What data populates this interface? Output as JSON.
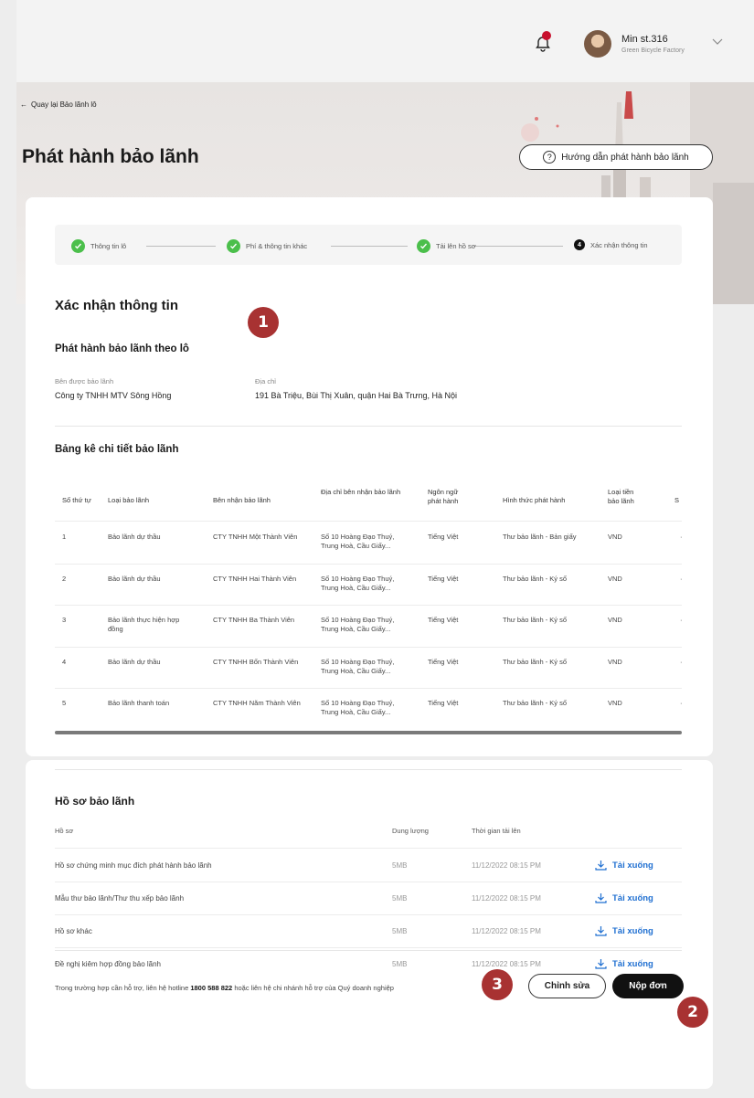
{
  "header": {
    "user_name": "Min st.316",
    "user_org": "Green Bicycle Factory"
  },
  "page": {
    "back_label": "Quay lại Bảo lãnh lô",
    "title": "Phát hành bảo lãnh",
    "guide_label": "Hướng dẫn phát hành bảo lãnh"
  },
  "stepper": {
    "steps": [
      {
        "label": "Thông tin lô",
        "state": "done"
      },
      {
        "label": "Phí & thông tin khác",
        "state": "done"
      },
      {
        "label": "Tải lên hồ sơ",
        "state": "done"
      },
      {
        "label": "Xác nhận thông tin",
        "state": "current",
        "number": "4"
      }
    ]
  },
  "markers": [
    "1",
    "2",
    "3"
  ],
  "confirm": {
    "title": "Xác nhận thông tin",
    "subtitle": "Phát hành bảo lãnh theo lô",
    "beneficiary_label": "Bên được bảo lãnh",
    "beneficiary_value": "Công ty TNHH MTV Sông Hồng",
    "address_label": "Địa chỉ",
    "address_value": "191 Bà Triệu, Bùi Thị Xuân, quận Hai Bà Trưng, Hà Nội"
  },
  "detail_table": {
    "title": "Bảng kê chi tiết bảo lãnh",
    "columns": [
      "Số thứ tự",
      "Loại bảo lãnh",
      "Bên nhận bảo lãnh",
      "Địa chỉ bên nhận bảo lãnh",
      "Ngôn ngữ phát hành",
      "Hình thức phát hành",
      "Loại tiền bảo lãnh",
      "S"
    ],
    "rows": [
      [
        "1",
        "Bảo lãnh dự thầu",
        "CTY TNHH Một Thành Viên",
        "Số 10 Hoàng Đạo Thuý, Trung Hoà, Cầu Giấy...",
        "Tiếng Việt",
        "Thư bảo lãnh - Bản giấy",
        "VND",
        "·"
      ],
      [
        "2",
        "Bảo lãnh dự thầu",
        "CTY TNHH Hai Thành Viên",
        "Số 10 Hoàng Đạo Thuý, Trung Hoà, Cầu Giấy...",
        "Tiếng Việt",
        "Thư bảo lãnh - Ký số",
        "VND",
        "·"
      ],
      [
        "3",
        "Bảo lãnh thực hiện hợp đồng",
        "CTY TNHH Ba Thành Viên",
        "Số 10 Hoàng Đạo Thuý, Trung Hoà, Cầu Giấy...",
        "Tiếng Việt",
        "Thư bảo lãnh - Ký số",
        "VND",
        "·"
      ],
      [
        "4",
        "Bảo lãnh dự thầu",
        "CTY TNHH Bốn Thành Viên",
        "Số 10 Hoàng Đạo Thuý, Trung Hoà, Cầu Giấy...",
        "Tiếng Việt",
        "Thư bảo lãnh - Ký số",
        "VND",
        "·"
      ],
      [
        "5",
        "Bảo lãnh thanh toán",
        "CTY TNHH Năm Thành Viên",
        "Số 10 Hoàng Đạo Thuý, Trung Hoà, Cầu Giấy...",
        "Tiếng Việt",
        "Thư bảo lãnh - Ký số",
        "VND",
        "·"
      ]
    ]
  },
  "documents": {
    "title": "Hồ sơ bảo lãnh",
    "columns": [
      "Hồ sơ",
      "Dung lượng",
      "Thời gian tải lên"
    ],
    "download_label": "Tải xuống",
    "rows": [
      {
        "name": "Hồ sơ chứng minh mục đích phát hành bảo lãnh",
        "size": "5MB",
        "time": "11/12/2022 08:15 PM"
      },
      {
        "name": "Mẫu thư bảo lãnh/Thư thu xếp bảo lãnh",
        "size": "5MB",
        "time": "11/12/2022 08:15 PM"
      },
      {
        "name": "Hồ sơ khác",
        "size": "5MB",
        "time": "11/12/2022 08:15 PM"
      },
      {
        "name": "Đề nghị kiêm hợp đồng bảo lãnh",
        "size": "5MB",
        "time": "11/12/2022 08:15 PM"
      }
    ]
  },
  "footer": {
    "note_prefix": "Trong trường hợp cần hỗ trợ, liên hệ hotline",
    "hotline": "1800 588 822",
    "note_suffix": "hoặc liên hệ chi nhánh hỗ trợ của Quý doanh nghiệp",
    "edit_label": "Chỉnh sửa",
    "submit_label": "Nộp đơn"
  }
}
